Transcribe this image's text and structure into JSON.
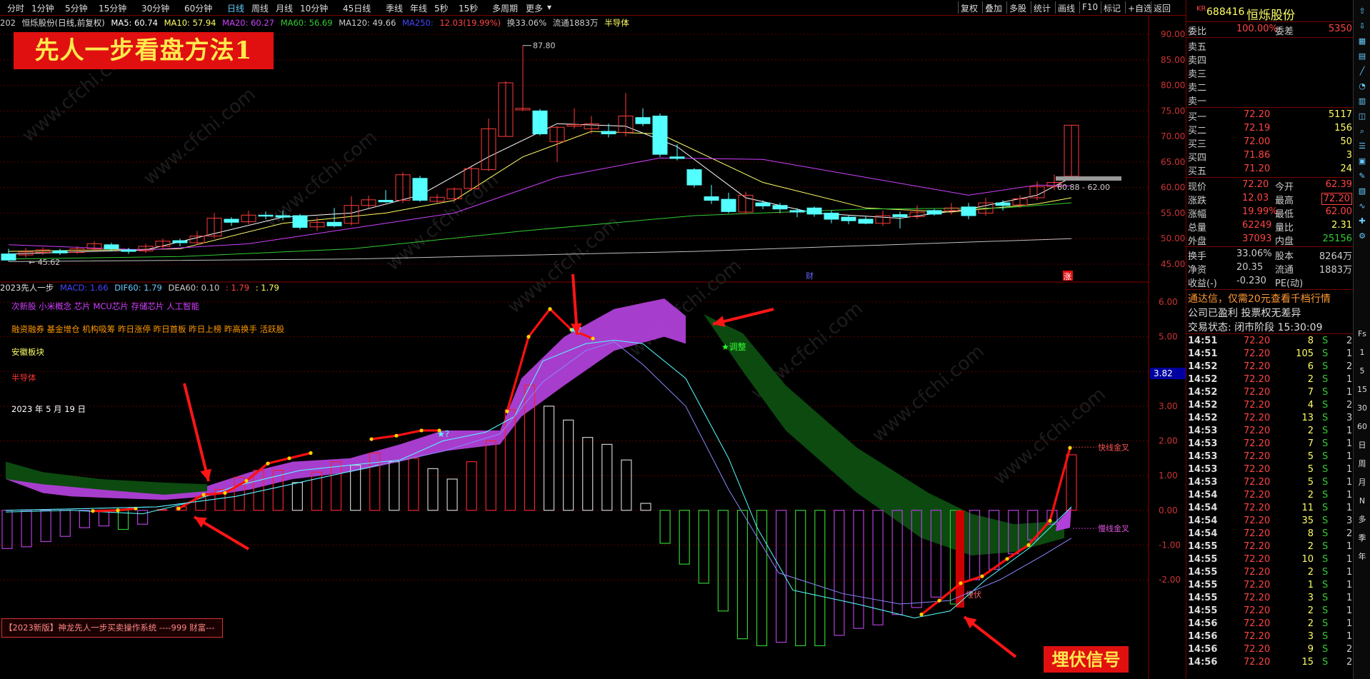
{
  "toolbar": {
    "periods": [
      "分时",
      "1分钟",
      "5分钟",
      "15分钟",
      "30分钟",
      "60分钟",
      "日线",
      "周线",
      "月线",
      "10分钟",
      "45日线",
      "季线",
      "年线",
      "5秒",
      "15秒",
      "多周期",
      "更多"
    ],
    "active_period": "日线",
    "right_buttons": [
      "复权",
      "叠加",
      "多股",
      "统计",
      "画线",
      "F10",
      "标记",
      "+自选",
      "返回"
    ]
  },
  "info": {
    "stock": "恒烁股份(日线,前复权)",
    "ma5": "MA5: 60.74",
    "ma10": "MA10: 57.94",
    "ma20": "MA20: 60.27",
    "ma60": "MA60: 56.69",
    "ma120": "MA120: 49.66",
    "ma250": "MA250:",
    "change": "12.03(19.99%)",
    "turnover": "换33.06%",
    "float": "流通1883万",
    "sector": "半导体",
    "date_prefix": "202"
  },
  "banner_title": "先人一步看盘方法1",
  "price_axis": [
    "90.00",
    "85.00",
    "80.00",
    "75.00",
    "70.00",
    "65.00",
    "60.00",
    "55.00",
    "50.00",
    "45.00"
  ],
  "price_labels": {
    "high": "87.80",
    "low": "45.62",
    "range": "60.88 - 62.00",
    "cai": "财",
    "zhang": "涨"
  },
  "indicator": {
    "header": "2023先人一步",
    "macd": "MACD: 1.66",
    "dif": "DIF60: 1.79",
    "dea": "DEA60: 0.10",
    "v1": ": 1.79",
    "v2": ": 1.79",
    "axis": [
      "6.00",
      "5.00",
      "4.00",
      "3.00",
      "2.00",
      "1.00",
      "0.00",
      "-1.00",
      "-2.00"
    ],
    "current": "3.82",
    "notes": {
      "concept": "次新股 小米概念 芯片 MCU芯片 存储芯片 人工智能",
      "tags": "融资融券 基金增仓 机构吸筹 昨日涨停 昨日首板 昨日上榜 昨高换手 活跃股",
      "region": "安徽板块",
      "industry": "半导体",
      "date": "2023 年 5 月 19 日"
    },
    "labels": {
      "adjust": "★调整",
      "fast_cross": "快线金叉",
      "slow_cross": "慢线金叉",
      "ambush": "埋伏",
      "star": "★?"
    }
  },
  "footer_text": "【2023新版】神龙先人一步买卖操作系统 ----999 财富---",
  "bottom_banner": "埋伏信号",
  "quote": {
    "code": "688416",
    "name": "恒烁股份",
    "badge": "KR",
    "weibi_label": "委比",
    "weibi": "100.00%",
    "weicha_label": "委差",
    "weicha": "5350",
    "sells": [
      "卖五",
      "卖四",
      "卖三",
      "卖二",
      "卖一"
    ],
    "buys": [
      {
        "l": "买一",
        "p": "72.20",
        "v": "5117"
      },
      {
        "l": "买二",
        "p": "72.19",
        "v": "156"
      },
      {
        "l": "买三",
        "p": "72.00",
        "v": "50"
      },
      {
        "l": "买四",
        "p": "71.86",
        "v": "3"
      },
      {
        "l": "买五",
        "p": "71.20",
        "v": "24"
      }
    ],
    "stats": [
      {
        "l1": "现价",
        "v1": "72.20",
        "l2": "今开",
        "v2": "62.39"
      },
      {
        "l1": "涨跌",
        "v1": "12.03",
        "l2": "最高",
        "v2": "72.20"
      },
      {
        "l1": "涨幅",
        "v1": "19.99%",
        "l2": "最低",
        "v2": "62.00"
      },
      {
        "l1": "总量",
        "v1": "62249",
        "l2": "量比",
        "v2": "2.31"
      },
      {
        "l1": "外盘",
        "v1": "37093",
        "l2": "内盘",
        "v2": "25156"
      }
    ],
    "stats2": [
      {
        "l1": "换手",
        "v1": "33.06%",
        "l2": "股本",
        "v2": "8264万"
      },
      {
        "l1": "净资",
        "v1": "20.35",
        "l2": "流通",
        "v2": "1883万"
      },
      {
        "l1": "收益(-)",
        "v1": "-0.230",
        "l2": "PE(动)",
        "v2": ""
      }
    ],
    "promo": "通达信，仅需20元查看千档行情",
    "status": "公司已盈利 投票权无差异",
    "trade_state": "交易状态: 闭市阶段 15:30:09"
  },
  "ticks": [
    [
      "14:51",
      "72.20",
      "8",
      "S",
      "2"
    ],
    [
      "14:51",
      "72.20",
      "105",
      "S",
      "1"
    ],
    [
      "14:52",
      "72.20",
      "6",
      "S",
      "2"
    ],
    [
      "14:52",
      "72.20",
      "2",
      "S",
      "1"
    ],
    [
      "14:52",
      "72.20",
      "7",
      "S",
      "1"
    ],
    [
      "14:52",
      "72.20",
      "4",
      "S",
      "2"
    ],
    [
      "14:52",
      "72.20",
      "13",
      "S",
      "3"
    ],
    [
      "14:53",
      "72.20",
      "2",
      "S",
      "1"
    ],
    [
      "14:53",
      "72.20",
      "7",
      "S",
      "1"
    ],
    [
      "14:53",
      "72.20",
      "5",
      "S",
      "1"
    ],
    [
      "14:53",
      "72.20",
      "5",
      "S",
      "1"
    ],
    [
      "14:53",
      "72.20",
      "5",
      "S",
      "1"
    ],
    [
      "14:54",
      "72.20",
      "2",
      "S",
      "1"
    ],
    [
      "14:54",
      "72.20",
      "11",
      "S",
      "1"
    ],
    [
      "14:54",
      "72.20",
      "35",
      "S",
      "3"
    ],
    [
      "14:54",
      "72.20",
      "8",
      "S",
      "2"
    ],
    [
      "14:55",
      "72.20",
      "2",
      "S",
      "1"
    ],
    [
      "14:55",
      "72.20",
      "10",
      "S",
      "1"
    ],
    [
      "14:55",
      "72.20",
      "2",
      "S",
      "1"
    ],
    [
      "14:55",
      "72.20",
      "1",
      "S",
      "1"
    ],
    [
      "14:55",
      "72.20",
      "3",
      "S",
      "1"
    ],
    [
      "14:55",
      "72.20",
      "2",
      "S",
      "1"
    ],
    [
      "14:56",
      "72.20",
      "2",
      "S",
      "1"
    ],
    [
      "14:56",
      "72.20",
      "3",
      "S",
      "1"
    ],
    [
      "14:56",
      "72.20",
      "9",
      "S",
      "2"
    ],
    [
      "14:56",
      "72.20",
      "15",
      "S",
      "2"
    ]
  ],
  "side_icons": [
    "up-arrow-icon",
    "down-arrow-icon",
    "grid-icon",
    "bars-icon",
    "line-icon",
    "pie-icon",
    "table-icon",
    "chart-icon",
    "search-icon",
    "list-icon",
    "cube-icon",
    "pen-icon",
    "tile-icon",
    "wave-icon",
    "plus-icon",
    "gear-icon"
  ],
  "side_text": [
    "Fs",
    "1",
    "5",
    "15",
    "30",
    "60",
    "日",
    "周",
    "月",
    "N",
    "多",
    "季",
    "年"
  ],
  "colors": {
    "up": "#ff3b3b",
    "down": "#54ffff",
    "ma5": "#ffffff",
    "ma10": "#ffff66",
    "ma20": "#d040ff",
    "ma60": "#33cc33",
    "ma120": "#c0c0c0",
    "purple": "#b040d8",
    "green": "#0c4a10",
    "red": "#ff1010"
  }
}
